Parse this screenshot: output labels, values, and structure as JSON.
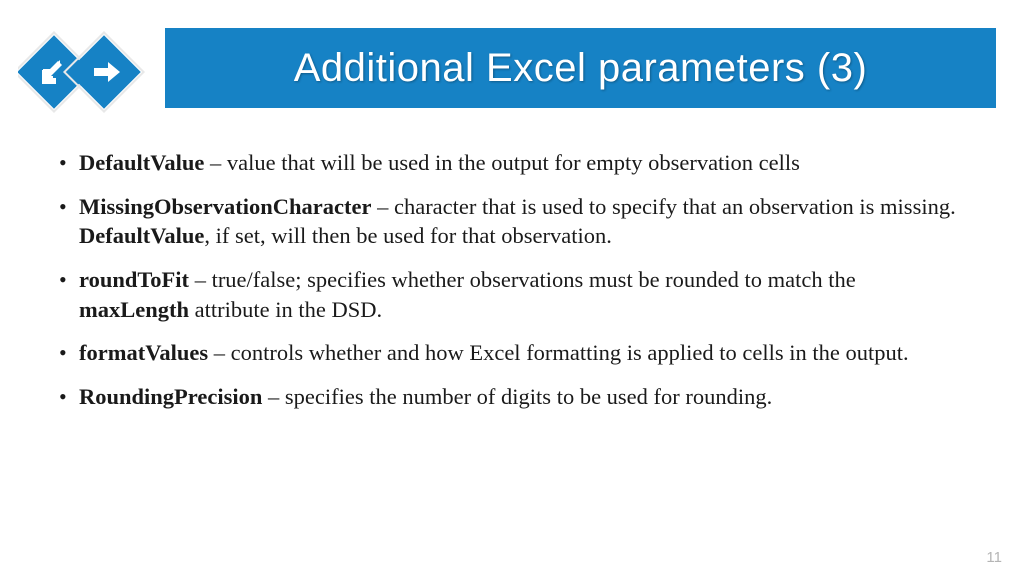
{
  "title": "Additional Excel parameters (3)",
  "bullets": [
    {
      "term": "DefaultValue",
      "separator": " – ",
      "text1": "value that will be used in the output for empty observation cells"
    },
    {
      "term": "MissingObservationCharacter",
      "separator": " – ",
      "text1": "character that is used to specify that an observation is missing. ",
      "boldInline": "DefaultValue",
      "text2": ", if set, will then be used for that observation."
    },
    {
      "term": "roundToFit",
      "separator": " – ",
      "text1": "true/false; specifies whether observations must be rounded to match the ",
      "boldInline": "maxLength",
      "text2": " attribute in the DSD."
    },
    {
      "term": "formatValues",
      "separator": " – ",
      "text1": "controls whether and how Excel formatting is applied to cells in the output."
    },
    {
      "term": "RoundingPrecision",
      "separator": " – ",
      "text1": "specifies the number of digits to be used for rounding."
    }
  ],
  "pageNumber": "11"
}
